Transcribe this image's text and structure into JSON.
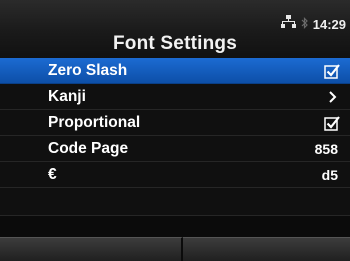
{
  "header": {
    "title": "Font Settings",
    "time": "14:29",
    "icons": [
      "network-icon",
      "bluetooth-icon"
    ]
  },
  "menu": {
    "items": [
      {
        "label": "Zero Slash",
        "indicator": "checked",
        "icon": "checkbox-checked-icon",
        "selected": true
      },
      {
        "label": "Kanji",
        "indicator": "submenu",
        "icon": "chevron-right-icon"
      },
      {
        "label": "Proportional",
        "indicator": "checked",
        "icon": "checkbox-checked-icon"
      },
      {
        "label": "Code Page",
        "value": "858"
      },
      {
        "label": "€",
        "value": "d5"
      }
    ]
  },
  "colors": {
    "selection": "#1565c8",
    "background": "#0b0b0b",
    "text": "#ffffff"
  }
}
